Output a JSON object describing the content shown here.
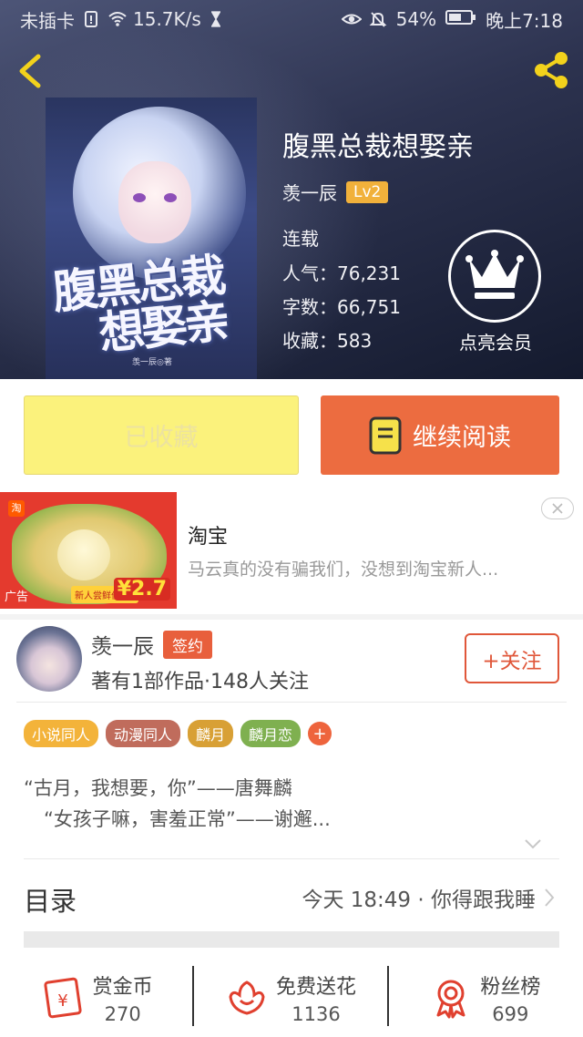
{
  "status_bar": {
    "carrier": "未插卡",
    "speed": "15.7K/s",
    "battery": "54%",
    "time": "晚上7:18"
  },
  "book": {
    "title": "腹黑总裁想娶亲",
    "cover_title_line1": "腹黑总裁",
    "cover_title_line2": "想娶亲",
    "cover_author": "羡一辰◎著",
    "author": "羡一辰",
    "level": "Lv2",
    "status": "连载",
    "popularity": "人气：76,231",
    "word_count": "字数：66,751",
    "favorites": "收藏：583"
  },
  "vip": {
    "label": "点亮会员"
  },
  "actions": {
    "collected_label": "已收藏",
    "continue_label": "继续阅读"
  },
  "ad": {
    "title": "淘宝",
    "description": "马云真的没有骗我们，没想到淘宝新人...",
    "tag": "广告",
    "promo": "新人尝鲜价5斤",
    "price": "¥2.7",
    "brand_mark": "淘"
  },
  "author_card": {
    "name": "羡一辰",
    "badge": "签约",
    "stats": "著有1部作品·148人关注",
    "follow_label": "+关注"
  },
  "tags": [
    {
      "label": "小说同人",
      "color": "#f3b33a"
    },
    {
      "label": "动漫同人",
      "color": "#c06c5c"
    },
    {
      "label": "麟月",
      "color": "#d8a035"
    },
    {
      "label": "麟月恋",
      "color": "#7fb050"
    }
  ],
  "tags_more": "+",
  "intro": {
    "line1": "“古月，我想要，你”——唐舞麟",
    "line2": "“女孩子嘛，害羞正常”——谢邂..."
  },
  "toc": {
    "label": "目录",
    "latest": "今天 18:49 · 你得跟我睡"
  },
  "bottom_bar": [
    {
      "label": "赏金币",
      "value": "270",
      "icon": "coin-envelope-icon"
    },
    {
      "label": "免费送花",
      "value": "1136",
      "icon": "flower-icon"
    },
    {
      "label": "粉丝榜",
      "value": "699",
      "icon": "medal-icon"
    }
  ],
  "colors": {
    "accent_orange": "#ec6c40",
    "collect_yellow": "#fbf27c",
    "icon_red": "#e0402f"
  }
}
